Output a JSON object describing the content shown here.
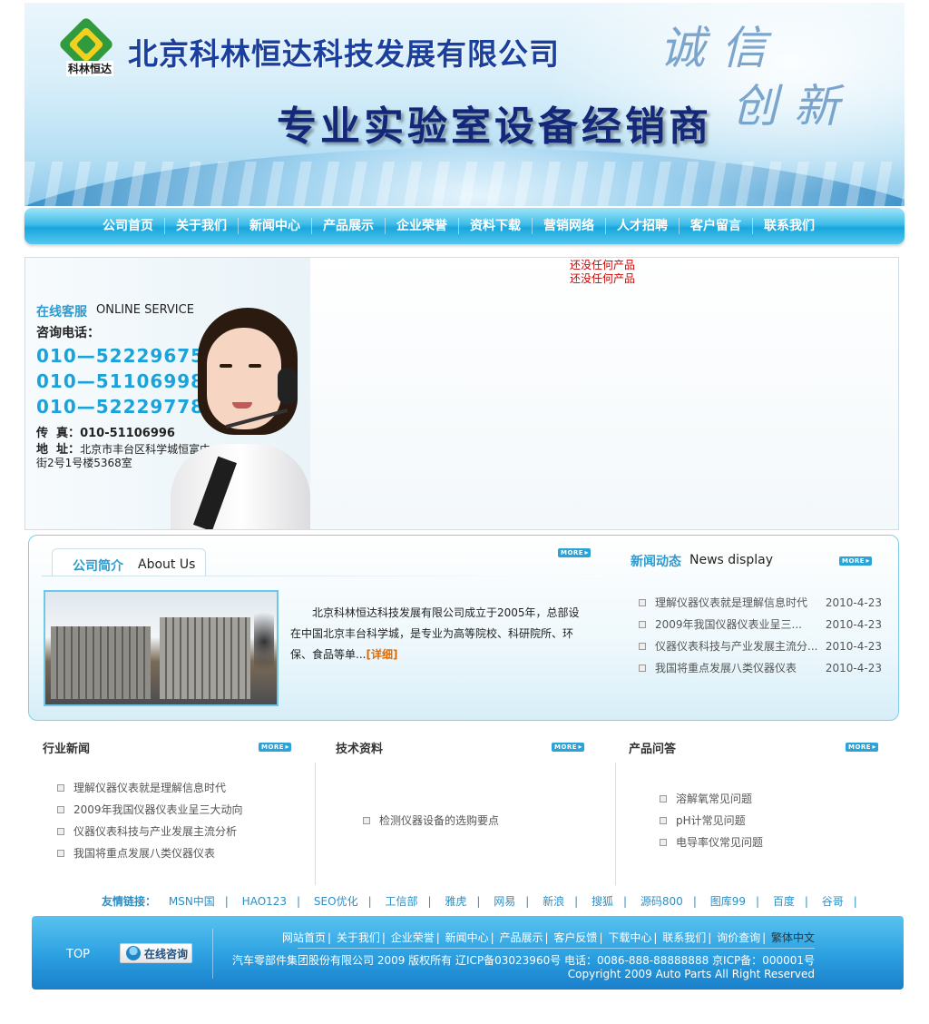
{
  "header": {
    "logo_text": "科林恒达",
    "company_name": "北京科林恒达科技发展有限公司",
    "slogan": "专业实验室设备经销商",
    "motto_line1": "诚信",
    "motto_line2": "创新"
  },
  "nav": {
    "items": [
      "公司首页",
      "关于我们",
      "新闻中心",
      "产品展示",
      "企业荣誉",
      "资料下载",
      "营销网络",
      "人才招聘",
      "客户留言",
      "联系我们"
    ]
  },
  "service": {
    "title": "在线客服",
    "title_en": "ONLINE SERVICE",
    "ask_label": "咨询电话：",
    "phones": [
      "010—52229675",
      "010—51106998",
      "010—52229778"
    ],
    "fax_label": "传  真：",
    "fax": "010-51106996",
    "address_label": "地  址：",
    "address": "北京市丰台区科学城恒富中街2号1号楼5368室"
  },
  "products": {
    "empty_1": "还没任何产品",
    "empty_2": "还没任何产品"
  },
  "about": {
    "title": "公司简介",
    "title_en": "About Us",
    "more": "MORE",
    "text": "北京科林恒达科技发展有限公司成立于2005年，总部设在中国北京丰台科学城，是专业为高等院校、科研院所、环保、食品等单...",
    "detail": "[详细]"
  },
  "news": {
    "title": "新闻动态",
    "title_en": "News display",
    "more": "MORE",
    "items": [
      {
        "title": "理解仪器仪表就是理解信息时代",
        "date": "2010-4-23"
      },
      {
        "title": "2009年我国仪器仪表业呈三...",
        "date": "2010-4-23"
      },
      {
        "title": "仪器仪表科技与产业发展主流分...",
        "date": "2010-4-23"
      },
      {
        "title": "我国将重点发展八类仪器仪表",
        "date": "2010-4-23"
      }
    ]
  },
  "columns": {
    "industry": {
      "title": "行业新闻",
      "more": "MORE",
      "items": [
        "理解仪器仪表就是理解信息时代",
        "2009年我国仪器仪表业呈三大动向",
        "仪器仪表科技与产业发展主流分析",
        "我国将重点发展八类仪器仪表"
      ]
    },
    "tech": {
      "title": "技术资料",
      "more": "MORE",
      "items": [
        "检测仪器设备的选购要点"
      ]
    },
    "faq": {
      "title": "产品问答",
      "more": "MORE",
      "items": [
        "溶解氧常见问题",
        "pH计常见问题",
        "电导率仪常见问题"
      ]
    }
  },
  "links": {
    "label": "友情链接：",
    "items": [
      "MSN中国",
      "HAO123",
      "SEO优化",
      "工信部",
      "雅虎",
      "网易",
      "新浪",
      "搜狐",
      "源码800",
      "图库99",
      "百度",
      "谷哥"
    ]
  },
  "footer": {
    "top": "TOP",
    "consult": "在线咨询",
    "nav": [
      "网站首页",
      "关于我们",
      "企业荣誉",
      "新闻中心",
      "产品展示",
      "客户反馈",
      "下载中心",
      "联系我们",
      "询价查询"
    ],
    "traditional": "繁体中文",
    "copyright_line1": "汽车零部件集团股份有限公司 2009 版权所有 辽ICP备03023960号 电话：0086-888-88888888 京ICP备：000001号",
    "copyright_line2": "Copyright 2009 Auto Parts All Right Reserved"
  },
  "colors": {
    "accent": "#2e9bcf",
    "nav_blue": "#19a6dd",
    "detail_orange": "#e06a00",
    "empty_red": "#cc0000"
  }
}
